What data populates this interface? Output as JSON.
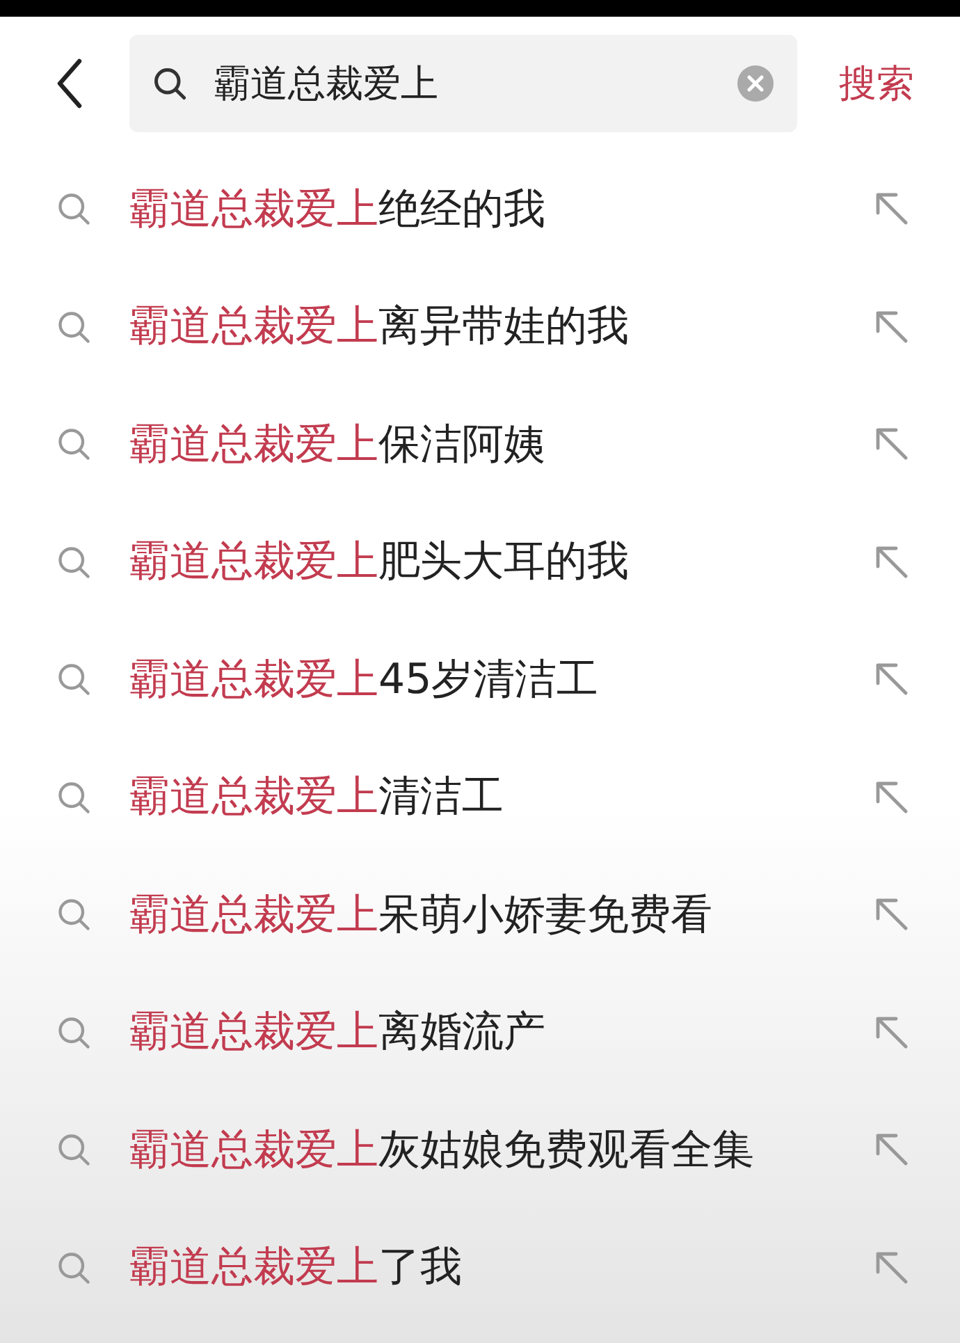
{
  "search": {
    "value": "霸道总裁爱上",
    "button": "搜索"
  },
  "suggestions": [
    {
      "match": "霸道总裁爱上",
      "rest": "绝经的我"
    },
    {
      "match": "霸道总裁爱上",
      "rest": "离异带娃的我"
    },
    {
      "match": "霸道总裁爱上",
      "rest": "保洁阿姨"
    },
    {
      "match": "霸道总裁爱上",
      "rest": "肥头大耳的我"
    },
    {
      "match": "霸道总裁爱上",
      "rest": "45岁清洁工"
    },
    {
      "match": "霸道总裁爱上",
      "rest": "清洁工"
    },
    {
      "match": "霸道总裁爱上",
      "rest": "呆萌小娇妻免费看"
    },
    {
      "match": "霸道总裁爱上",
      "rest": "离婚流产"
    },
    {
      "match": "霸道总裁爱上",
      "rest": "灰姑娘免费观看全集"
    },
    {
      "match": "霸道总裁爱上",
      "rest": "了我"
    }
  ]
}
